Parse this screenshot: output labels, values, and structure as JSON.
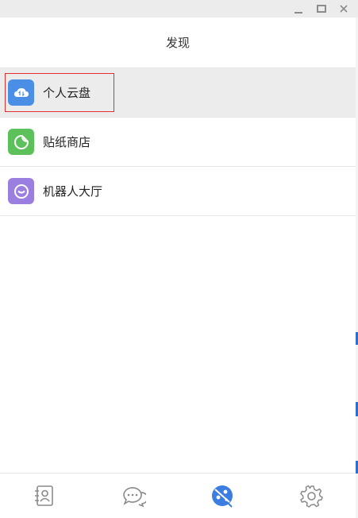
{
  "window": {
    "controls": [
      "minimize",
      "maximize",
      "close"
    ]
  },
  "header": {
    "title": "发现"
  },
  "menu": {
    "items": [
      {
        "label": "个人云盘",
        "icon": "cloud-icon",
        "color": "#4a8ee6",
        "selected": true
      },
      {
        "label": "贴纸商店",
        "icon": "sticker-icon",
        "color": "#5cc15a",
        "selected": false
      },
      {
        "label": "机器人大厅",
        "icon": "robot-icon",
        "color": "#9b7fe0",
        "selected": false
      }
    ]
  },
  "bottom_nav": {
    "tabs": [
      {
        "name": "contacts",
        "icon": "contacts-icon",
        "active": false
      },
      {
        "name": "chat",
        "icon": "chat-icon",
        "active": false
      },
      {
        "name": "discover",
        "icon": "discover-icon",
        "active": true
      },
      {
        "name": "settings",
        "icon": "settings-icon",
        "active": false
      }
    ]
  },
  "colors": {
    "accent": "#3b7de0",
    "highlight_border": "#e0302e",
    "selected_row": "#ececec",
    "divider": "#e6e6e6",
    "inactive_icon": "#8a8a8a"
  }
}
